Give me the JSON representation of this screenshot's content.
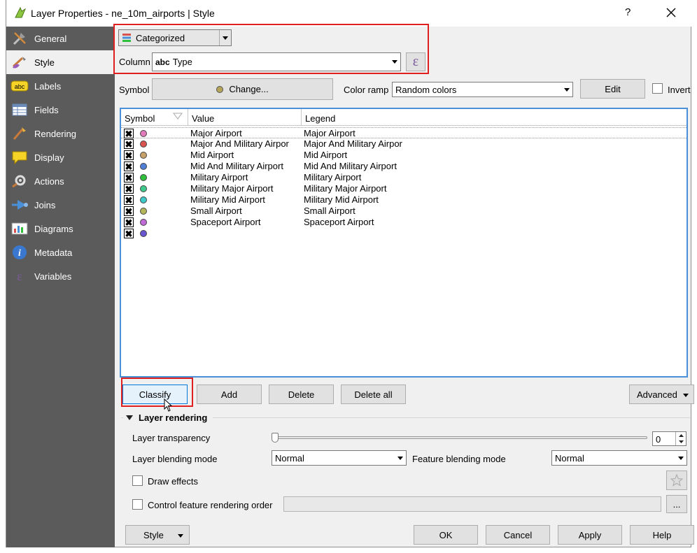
{
  "window": {
    "title": "Layer Properties - ne_10m_airports | Style",
    "help": "?"
  },
  "sidebar": {
    "items": [
      {
        "label": "General",
        "icon": "general-icon"
      },
      {
        "label": "Style",
        "icon": "style-icon"
      },
      {
        "label": "Labels",
        "icon": "labels-icon"
      },
      {
        "label": "Fields",
        "icon": "fields-icon"
      },
      {
        "label": "Rendering",
        "icon": "rendering-icon"
      },
      {
        "label": "Display",
        "icon": "display-icon"
      },
      {
        "label": "Actions",
        "icon": "actions-icon"
      },
      {
        "label": "Joins",
        "icon": "joins-icon"
      },
      {
        "label": "Diagrams",
        "icon": "diagrams-icon"
      },
      {
        "label": "Metadata",
        "icon": "metadata-icon"
      },
      {
        "label": "Variables",
        "icon": "variables-icon"
      }
    ],
    "active": "Style"
  },
  "renderer": {
    "type": "Categorized",
    "column_label": "Column",
    "column_prefix": "abc",
    "column_value": "Type"
  },
  "symbol": {
    "label": "Symbol",
    "change_button": "Change...",
    "color_ramp_label": "Color ramp",
    "color_ramp_value": "Random colors",
    "edit_button": "Edit",
    "invert_label": "Invert"
  },
  "table": {
    "headers": [
      "Symbol",
      "Value",
      "Legend"
    ],
    "rows": [
      {
        "value": "Major Airport",
        "legend": "Major Airport",
        "color": "#e07ab8"
      },
      {
        "value": "Major And Military Airpor",
        "legend": "Major And Military Airpor",
        "color": "#d9534f"
      },
      {
        "value": "Mid Airport",
        "legend": "Mid Airport",
        "color": "#c8a06a"
      },
      {
        "value": "Mid And Military Airport",
        "legend": "Mid And Military Airport",
        "color": "#4f7fd6"
      },
      {
        "value": "Military Airport",
        "legend": "Military Airport",
        "color": "#2fbf3a"
      },
      {
        "value": "Military Major Airport",
        "legend": "Military Major Airport",
        "color": "#3ec98a"
      },
      {
        "value": "Military Mid Airport",
        "legend": "Military Mid Airport",
        "color": "#3fc8c8"
      },
      {
        "value": "Small Airport",
        "legend": "Small Airport",
        "color": "#b5b55a"
      },
      {
        "value": "Spaceport Airport",
        "legend": "Spaceport Airport",
        "color": "#c06ad8"
      },
      {
        "value": "",
        "legend": "",
        "color": "#6a55d0"
      }
    ]
  },
  "actions": {
    "classify": "Classify",
    "add": "Add",
    "delete": "Delete",
    "delete_all": "Delete all",
    "advanced": "Advanced"
  },
  "layer_rendering": {
    "title": "Layer rendering",
    "transparency_label": "Layer transparency",
    "transparency_value": "0",
    "transparency_level": 0,
    "blending_label": "Layer blending mode",
    "blending_value": "Normal",
    "feature_blending_label": "Feature blending mode",
    "feature_blending_value": "Normal",
    "draw_effects_label": "Draw effects",
    "control_order_label": "Control feature rendering order",
    "ellipsis": "..."
  },
  "footer": {
    "style": "Style",
    "ok": "OK",
    "cancel": "Cancel",
    "apply": "Apply",
    "help": "Help"
  }
}
